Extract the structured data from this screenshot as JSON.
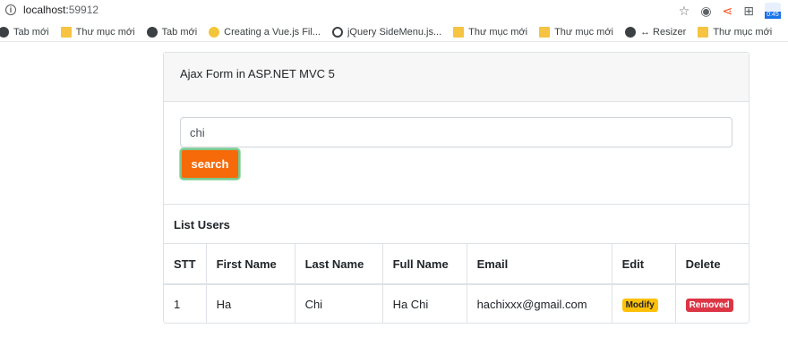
{
  "browser": {
    "url_host": "localhost:",
    "url_port": "59912",
    "bookmarks": [
      {
        "label": "Tab mới",
        "icon": "globe-icon"
      },
      {
        "label": "Thư mục mới",
        "icon": "folder-icon"
      },
      {
        "label": "Tab mới",
        "icon": "globe-icon"
      },
      {
        "label": "Creating a Vue.js Fil...",
        "icon": "vue-icon"
      },
      {
        "label": "jQuery SideMenu.js...",
        "icon": "jquery-icon"
      },
      {
        "label": "Thư mục mới",
        "icon": "folder-icon"
      },
      {
        "label": "Thư mục mới",
        "icon": "folder-icon"
      },
      {
        "label": "↔ Resizer",
        "icon": "globe-icon"
      },
      {
        "label": "Thư mục mới",
        "icon": "folder-icon"
      }
    ],
    "extension_badge": "0:45"
  },
  "card": {
    "header": "Ajax Form in ASP.NET MVC 5",
    "search_value": "chi",
    "search_button": "search",
    "list_title": "List Users"
  },
  "table": {
    "headers": [
      "STT",
      "First Name",
      "Last Name",
      "Full Name",
      "Email",
      "Edit",
      "Delete"
    ],
    "rows": [
      {
        "stt": "1",
        "first": "Ha",
        "last": "Chi",
        "full": "Ha Chi",
        "email": "hachixxx@gmail.com",
        "edit": "Modify",
        "delete": "Removed"
      }
    ]
  },
  "colors": {
    "search_button": "#f66a0a",
    "modify_badge": "#ffc107",
    "removed_badge": "#dc3545"
  }
}
